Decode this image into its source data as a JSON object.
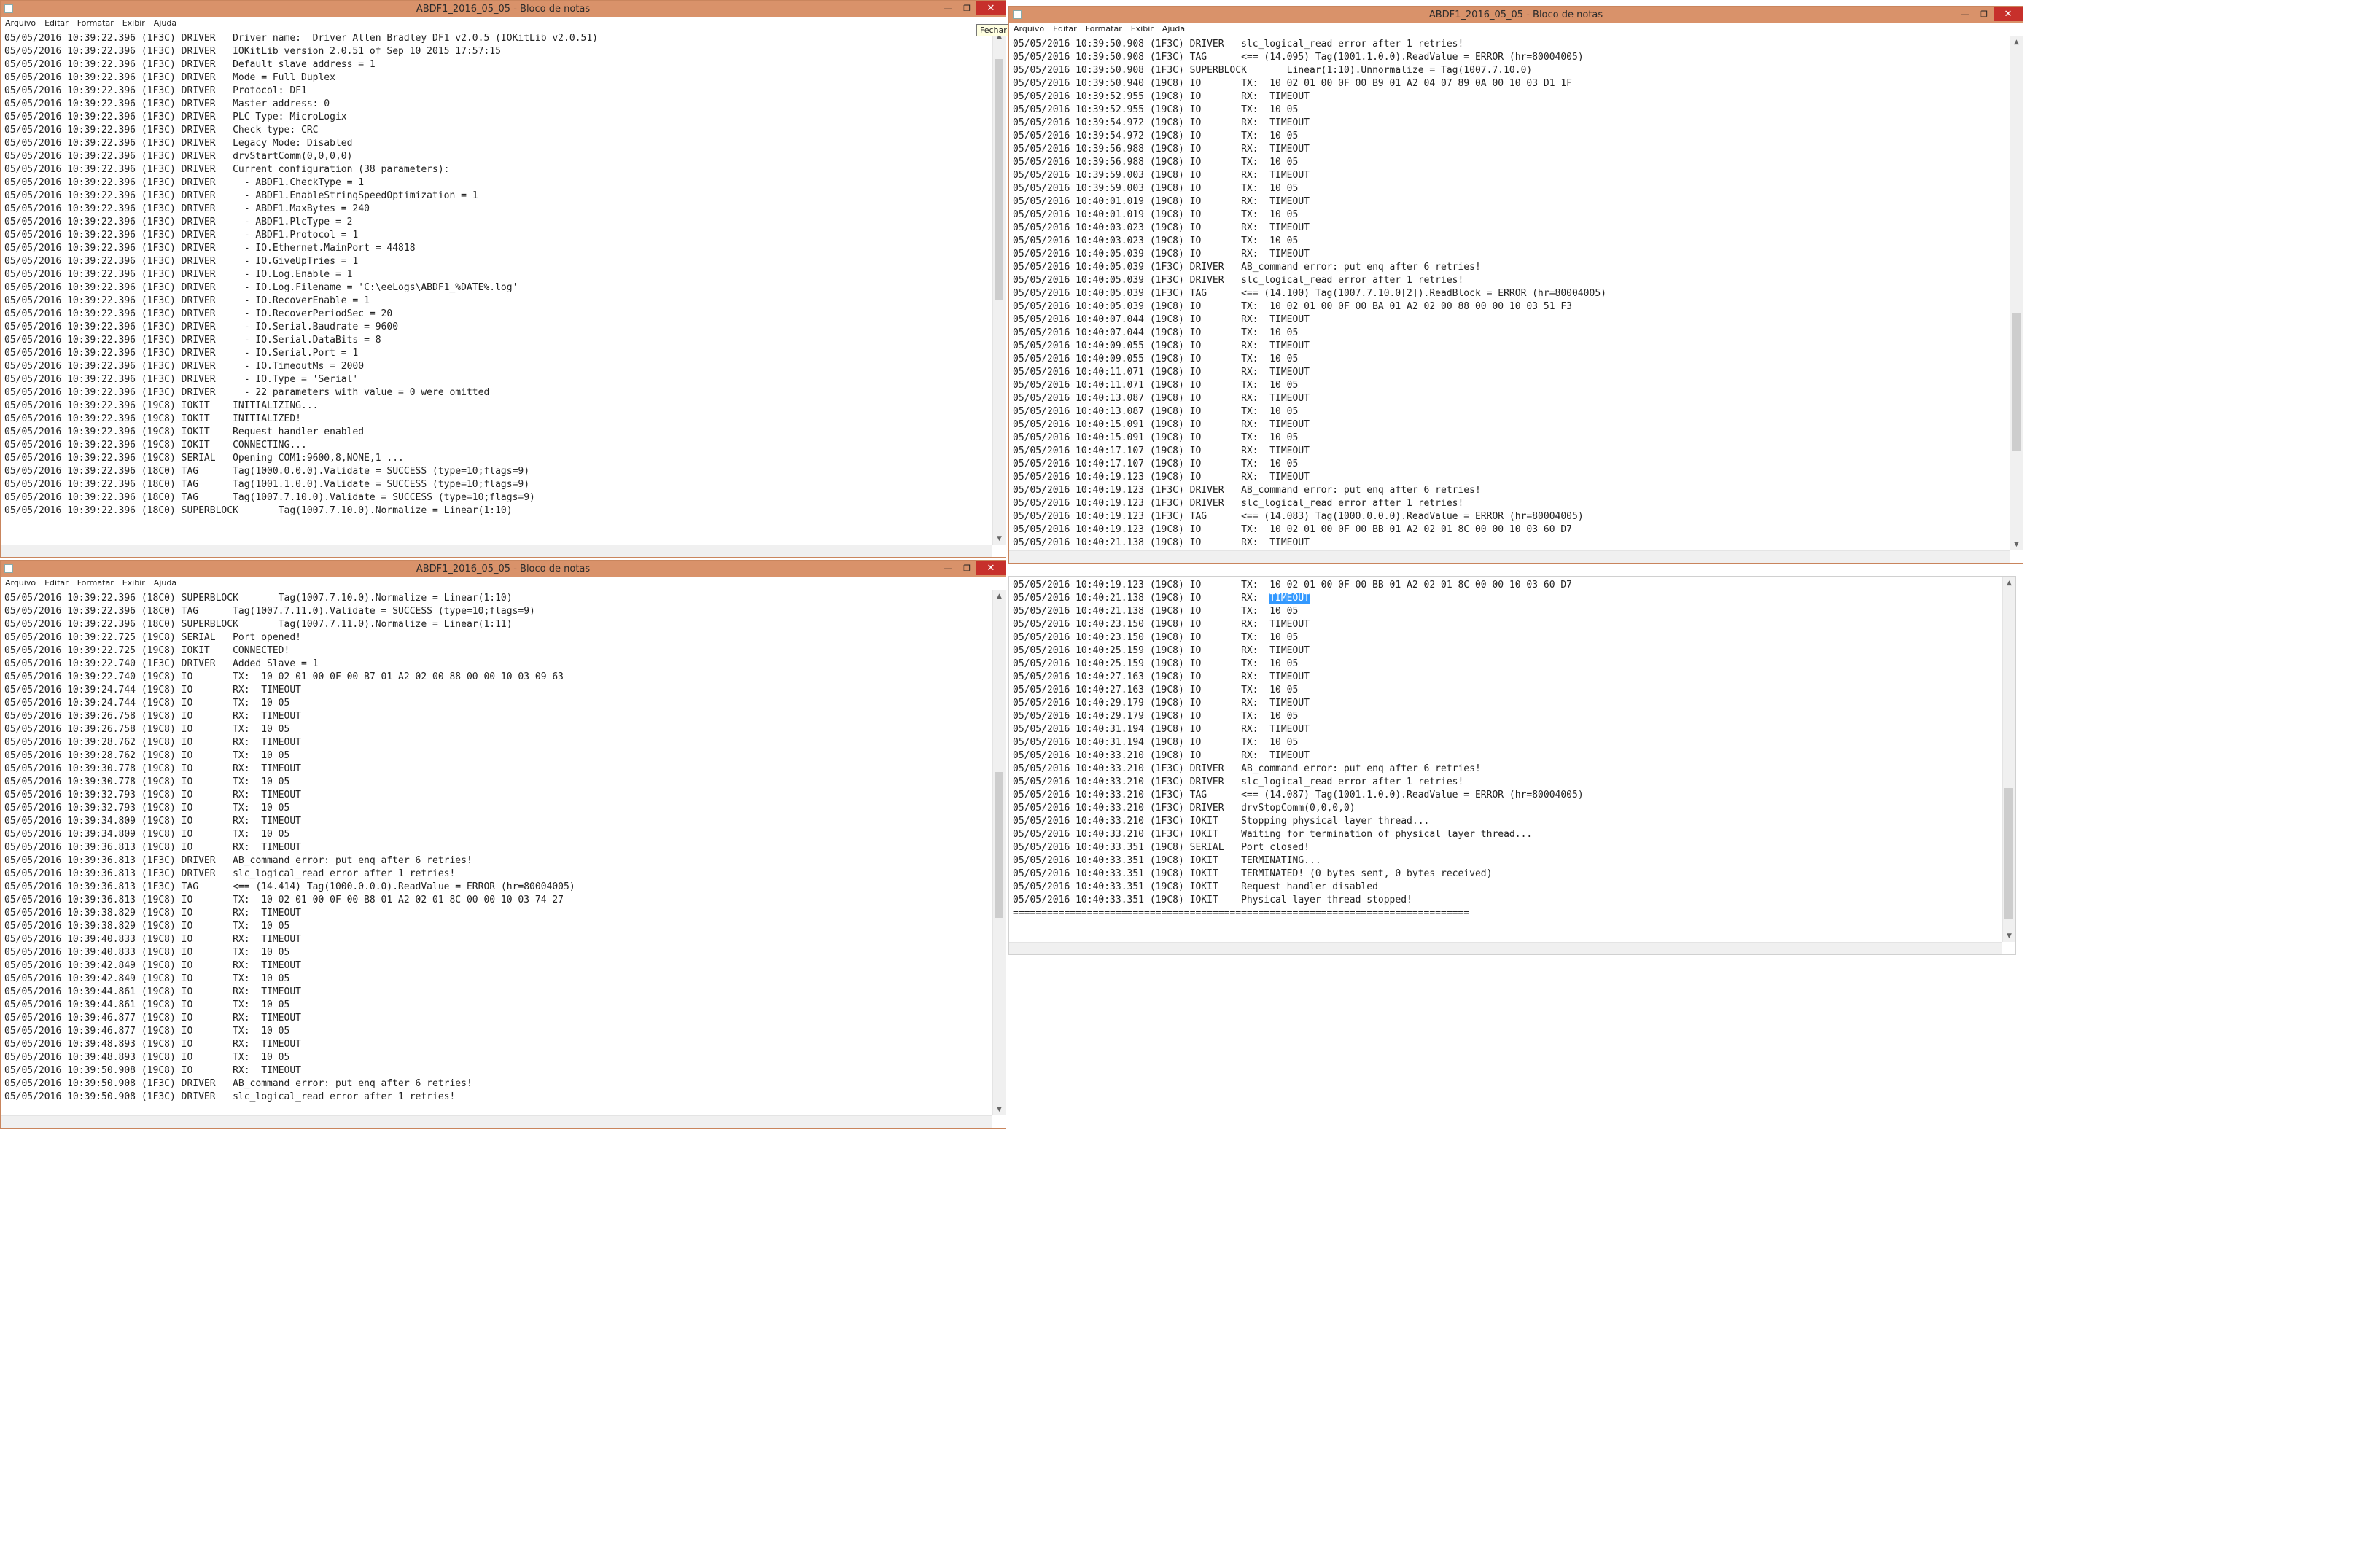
{
  "menu": [
    "Arquivo",
    "Editar",
    "Formatar",
    "Exibir",
    "Ajuda"
  ],
  "icons": {
    "minimize": "minimize-icon",
    "maximize": "maximize-icon",
    "close": "close-icon",
    "app": "notepad-icon"
  },
  "close_tooltip": "Fechar",
  "windows": [
    {
      "title": "ABDF1_2016_05_05 - Bloco de notas",
      "lines": [
        "",
        "05/05/2016 10:39:22.396 (1F3C) DRIVER   Driver name:  Driver Allen Bradley DF1 v2.0.5 (IOKitLib v2.0.51)",
        "05/05/2016 10:39:22.396 (1F3C) DRIVER   IOKitLib version 2.0.51 of Sep 10 2015 17:57:15",
        "05/05/2016 10:39:22.396 (1F3C) DRIVER   Default slave address = 1",
        "",
        "05/05/2016 10:39:22.396 (1F3C) DRIVER   Mode = Full Duplex",
        "05/05/2016 10:39:22.396 (1F3C) DRIVER   Protocol: DF1",
        "05/05/2016 10:39:22.396 (1F3C) DRIVER   Master address: 0",
        "05/05/2016 10:39:22.396 (1F3C) DRIVER   PLC Type: MicroLogix",
        "05/05/2016 10:39:22.396 (1F3C) DRIVER   Check type: CRC",
        "05/05/2016 10:39:22.396 (1F3C) DRIVER   Legacy Mode: Disabled",
        "05/05/2016 10:39:22.396 (1F3C) DRIVER   drvStartComm(0,0,0,0)",
        "05/05/2016 10:39:22.396 (1F3C) DRIVER   Current configuration (38 parameters):",
        "05/05/2016 10:39:22.396 (1F3C) DRIVER     - ABDF1.CheckType = 1",
        "05/05/2016 10:39:22.396 (1F3C) DRIVER     - ABDF1.EnableStringSpeedOptimization = 1",
        "05/05/2016 10:39:22.396 (1F3C) DRIVER     - ABDF1.MaxBytes = 240",
        "05/05/2016 10:39:22.396 (1F3C) DRIVER     - ABDF1.PlcType = 2",
        "05/05/2016 10:39:22.396 (1F3C) DRIVER     - ABDF1.Protocol = 1",
        "05/05/2016 10:39:22.396 (1F3C) DRIVER     - IO.Ethernet.MainPort = 44818",
        "05/05/2016 10:39:22.396 (1F3C) DRIVER     - IO.GiveUpTries = 1",
        "05/05/2016 10:39:22.396 (1F3C) DRIVER     - IO.Log.Enable = 1",
        "05/05/2016 10:39:22.396 (1F3C) DRIVER     - IO.Log.Filename = 'C:\\eeLogs\\ABDF1_%DATE%.log'",
        "05/05/2016 10:39:22.396 (1F3C) DRIVER     - IO.RecoverEnable = 1",
        "05/05/2016 10:39:22.396 (1F3C) DRIVER     - IO.RecoverPeriodSec = 20",
        "05/05/2016 10:39:22.396 (1F3C) DRIVER     - IO.Serial.Baudrate = 9600",
        "05/05/2016 10:39:22.396 (1F3C) DRIVER     - IO.Serial.DataBits = 8",
        "05/05/2016 10:39:22.396 (1F3C) DRIVER     - IO.Serial.Port = 1",
        "05/05/2016 10:39:22.396 (1F3C) DRIVER     - IO.TimeoutMs = 2000",
        "05/05/2016 10:39:22.396 (1F3C) DRIVER     - IO.Type = 'Serial'",
        "05/05/2016 10:39:22.396 (1F3C) DRIVER     - 22 parameters with value = 0 were omitted",
        "05/05/2016 10:39:22.396 (19C8) IOKIT    INITIALIZING...",
        "05/05/2016 10:39:22.396 (19C8) IOKIT    INITIALIZED!",
        "05/05/2016 10:39:22.396 (19C8) IOKIT    Request handler enabled",
        "05/05/2016 10:39:22.396 (19C8) IOKIT    CONNECTING...",
        "05/05/2016 10:39:22.396 (19C8) SERIAL   Opening COM1:9600,8,NONE,1 ...",
        "05/05/2016 10:39:22.396 (18C0) TAG      Tag(1000.0.0.0).Validate = SUCCESS (type=10;flags=9)",
        "05/05/2016 10:39:22.396 (18C0) TAG      Tag(1001.1.0.0).Validate = SUCCESS (type=10;flags=9)",
        "05/05/2016 10:39:22.396 (18C0) TAG      Tag(1007.7.10.0).Validate = SUCCESS (type=10;flags=9)",
        "05/05/2016 10:39:22.396 (18C0) SUPERBLOCK       Tag(1007.7.10.0).Normalize = Linear(1:10)"
      ]
    },
    {
      "title": "ABDF1_2016_05_05 - Bloco de notas",
      "lines": [
        "05/05/2016 10:39:50.908 (1F3C) DRIVER   slc_logical_read error after 1 retries!",
        "05/05/2016 10:39:50.908 (1F3C) TAG      <== (14.095) Tag(1001.1.0.0).ReadValue = ERROR (hr=80004005)",
        "05/05/2016 10:39:50.908 (1F3C) SUPERBLOCK       Linear(1:10).Unnormalize = Tag(1007.7.10.0)",
        "05/05/2016 10:39:50.940 (19C8) IO       TX:  10 02 01 00 0F 00 B9 01 A2 04 07 89 0A 00 10 03 D1 1F",
        "05/05/2016 10:39:52.955 (19C8) IO       RX:  TIMEOUT",
        "05/05/2016 10:39:52.955 (19C8) IO       TX:  10 05",
        "05/05/2016 10:39:54.972 (19C8) IO       RX:  TIMEOUT",
        "05/05/2016 10:39:54.972 (19C8) IO       TX:  10 05",
        "05/05/2016 10:39:56.988 (19C8) IO       RX:  TIMEOUT",
        "05/05/2016 10:39:56.988 (19C8) IO       TX:  10 05",
        "05/05/2016 10:39:59.003 (19C8) IO       RX:  TIMEOUT",
        "05/05/2016 10:39:59.003 (19C8) IO       TX:  10 05",
        "05/05/2016 10:40:01.019 (19C8) IO       RX:  TIMEOUT",
        "05/05/2016 10:40:01.019 (19C8) IO       TX:  10 05",
        "05/05/2016 10:40:03.023 (19C8) IO       RX:  TIMEOUT",
        "05/05/2016 10:40:03.023 (19C8) IO       TX:  10 05",
        "05/05/2016 10:40:05.039 (19C8) IO       RX:  TIMEOUT",
        "05/05/2016 10:40:05.039 (1F3C) DRIVER   AB_command error: put enq after 6 retries!",
        "05/05/2016 10:40:05.039 (1F3C) DRIVER   slc_logical_read error after 1 retries!",
        "05/05/2016 10:40:05.039 (1F3C) TAG      <== (14.100) Tag(1007.7.10.0[2]).ReadBlock = ERROR (hr=80004005)",
        "05/05/2016 10:40:05.039 (19C8) IO       TX:  10 02 01 00 0F 00 BA 01 A2 02 00 88 00 00 10 03 51 F3",
        "05/05/2016 10:40:07.044 (19C8) IO       RX:  TIMEOUT",
        "05/05/2016 10:40:07.044 (19C8) IO       TX:  10 05",
        "05/05/2016 10:40:09.055 (19C8) IO       RX:  TIMEOUT",
        "05/05/2016 10:40:09.055 (19C8) IO       TX:  10 05",
        "05/05/2016 10:40:11.071 (19C8) IO       RX:  TIMEOUT",
        "05/05/2016 10:40:11.071 (19C8) IO       TX:  10 05",
        "05/05/2016 10:40:13.087 (19C8) IO       RX:  TIMEOUT",
        "05/05/2016 10:40:13.087 (19C8) IO       TX:  10 05",
        "05/05/2016 10:40:15.091 (19C8) IO       RX:  TIMEOUT",
        "05/05/2016 10:40:15.091 (19C8) IO       TX:  10 05",
        "05/05/2016 10:40:17.107 (19C8) IO       RX:  TIMEOUT",
        "05/05/2016 10:40:17.107 (19C8) IO       TX:  10 05",
        "05/05/2016 10:40:19.123 (19C8) IO       RX:  TIMEOUT",
        "05/05/2016 10:40:19.123 (1F3C) DRIVER   AB_command error: put enq after 6 retries!",
        "05/05/2016 10:40:19.123 (1F3C) DRIVER   slc_logical_read error after 1 retries!",
        "05/05/2016 10:40:19.123 (1F3C) TAG      <== (14.083) Tag(1000.0.0.0).ReadValue = ERROR (hr=80004005)",
        "05/05/2016 10:40:19.123 (19C8) IO       TX:  10 02 01 00 0F 00 BB 01 A2 02 01 8C 00 00 10 03 60 D7",
        "05/05/2016 10:40:21.138 (19C8) IO       RX:  TIMEOUT"
      ]
    },
    {
      "title": "ABDF1_2016_05_05 - Bloco de notas",
      "lines": [
        "05/05/2016 10:39:22.396 (18C0) SUPERBLOCK       Tag(1007.7.10.0).Normalize = Linear(1:10)",
        "05/05/2016 10:39:22.396 (18C0) TAG      Tag(1007.7.11.0).Validate = SUCCESS (type=10;flags=9)",
        "05/05/2016 10:39:22.396 (18C0) SUPERBLOCK       Tag(1007.7.11.0).Normalize = Linear(1:11)",
        "05/05/2016 10:39:22.725 (19C8) SERIAL   Port opened!",
        "05/05/2016 10:39:22.725 (19C8) IOKIT    CONNECTED!",
        "05/05/2016 10:39:22.740 (1F3C) DRIVER   Added Slave = 1",
        "05/05/2016 10:39:22.740 (19C8) IO       TX:  10 02 01 00 0F 00 B7 01 A2 02 00 88 00 00 10 03 09 63",
        "05/05/2016 10:39:24.744 (19C8) IO       RX:  TIMEOUT",
        "05/05/2016 10:39:24.744 (19C8) IO       TX:  10 05",
        "05/05/2016 10:39:26.758 (19C8) IO       RX:  TIMEOUT",
        "05/05/2016 10:39:26.758 (19C8) IO       TX:  10 05",
        "05/05/2016 10:39:28.762 (19C8) IO       RX:  TIMEOUT",
        "05/05/2016 10:39:28.762 (19C8) IO       TX:  10 05",
        "05/05/2016 10:39:30.778 (19C8) IO       RX:  TIMEOUT",
        "05/05/2016 10:39:30.778 (19C8) IO       TX:  10 05",
        "05/05/2016 10:39:32.793 (19C8) IO       RX:  TIMEOUT",
        "05/05/2016 10:39:32.793 (19C8) IO       TX:  10 05",
        "05/05/2016 10:39:34.809 (19C8) IO       RX:  TIMEOUT",
        "05/05/2016 10:39:34.809 (19C8) IO       TX:  10 05",
        "05/05/2016 10:39:36.813 (19C8) IO       RX:  TIMEOUT",
        "05/05/2016 10:39:36.813 (1F3C) DRIVER   AB_command error: put enq after 6 retries!",
        "05/05/2016 10:39:36.813 (1F3C) DRIVER   slc_logical_read error after 1 retries!",
        "05/05/2016 10:39:36.813 (1F3C) TAG      <== (14.414) Tag(1000.0.0.0).ReadValue = ERROR (hr=80004005)",
        "05/05/2016 10:39:36.813 (19C8) IO       TX:  10 02 01 00 0F 00 B8 01 A2 02 01 8C 00 00 10 03 74 27",
        "05/05/2016 10:39:38.829 (19C8) IO       RX:  TIMEOUT",
        "05/05/2016 10:39:38.829 (19C8) IO       TX:  10 05",
        "05/05/2016 10:39:40.833 (19C8) IO       RX:  TIMEOUT",
        "05/05/2016 10:39:40.833 (19C8) IO       TX:  10 05",
        "05/05/2016 10:39:42.849 (19C8) IO       RX:  TIMEOUT",
        "05/05/2016 10:39:42.849 (19C8) IO       TX:  10 05",
        "05/05/2016 10:39:44.861 (19C8) IO       RX:  TIMEOUT",
        "05/05/2016 10:39:44.861 (19C8) IO       TX:  10 05",
        "05/05/2016 10:39:46.877 (19C8) IO       RX:  TIMEOUT",
        "05/05/2016 10:39:46.877 (19C8) IO       TX:  10 05",
        "05/05/2016 10:39:48.893 (19C8) IO       RX:  TIMEOUT",
        "05/05/2016 10:39:48.893 (19C8) IO       TX:  10 05",
        "05/05/2016 10:39:50.908 (19C8) IO       RX:  TIMEOUT",
        "05/05/2016 10:39:50.908 (1F3C) DRIVER   AB_command error: put enq after 6 retries!",
        "05/05/2016 10:39:50.908 (1F3C) DRIVER   slc_logical_read error after 1 retries!"
      ]
    },
    {
      "title": "",
      "lines": [
        "05/05/2016 10:40:19.123 (19C8) IO       TX:  10 02 01 00 0F 00 BB 01 A2 02 01 8C 00 00 10 03 60 D7",
        "05/05/2016 10:40:21.138 (19C8) IO       RX:  TIMEOUT",
        "05/05/2016 10:40:21.138 (19C8) IO       TX:  10 05",
        "05/05/2016 10:40:23.150 (19C8) IO       RX:  TIMEOUT",
        "05/05/2016 10:40:23.150 (19C8) IO       TX:  10 05",
        "05/05/2016 10:40:25.159 (19C8) IO       RX:  TIMEOUT",
        "05/05/2016 10:40:25.159 (19C8) IO       TX:  10 05",
        "05/05/2016 10:40:27.163 (19C8) IO       RX:  TIMEOUT",
        "05/05/2016 10:40:27.163 (19C8) IO       TX:  10 05",
        "05/05/2016 10:40:29.179 (19C8) IO       RX:  TIMEOUT",
        "05/05/2016 10:40:29.179 (19C8) IO       TX:  10 05",
        "05/05/2016 10:40:31.194 (19C8) IO       RX:  TIMEOUT",
        "05/05/2016 10:40:31.194 (19C8) IO       TX:  10 05",
        "05/05/2016 10:40:33.210 (19C8) IO       RX:  TIMEOUT",
        "05/05/2016 10:40:33.210 (1F3C) DRIVER   AB_command error: put enq after 6 retries!",
        "05/05/2016 10:40:33.210 (1F3C) DRIVER   slc_logical_read error after 1 retries!",
        "05/05/2016 10:40:33.210 (1F3C) TAG      <== (14.087) Tag(1001.1.0.0).ReadValue = ERROR (hr=80004005)",
        "05/05/2016 10:40:33.210 (1F3C) DRIVER   drvStopComm(0,0,0,0)",
        "05/05/2016 10:40:33.210 (1F3C) IOKIT    Stopping physical layer thread...",
        "05/05/2016 10:40:33.210 (1F3C) IOKIT    Waiting for termination of physical layer thread...",
        "05/05/2016 10:40:33.351 (19C8) SERIAL   Port closed!",
        "05/05/2016 10:40:33.351 (19C8) IOKIT    TERMINATING...",
        "05/05/2016 10:40:33.351 (19C8) IOKIT    TERMINATED! (0 bytes sent, 0 bytes received)",
        "05/05/2016 10:40:33.351 (19C8) IOKIT    Request handler disabled",
        "05/05/2016 10:40:33.351 (19C8) IOKIT    Physical layer thread stopped!",
        "================================================================================"
      ]
    }
  ]
}
